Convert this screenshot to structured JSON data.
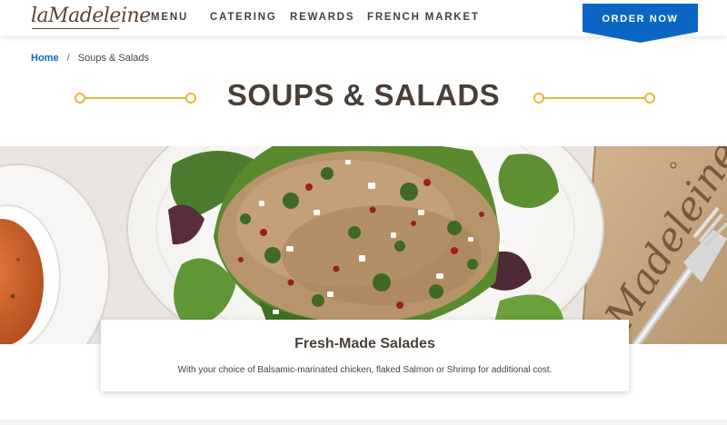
{
  "header": {
    "logo_text": "laMadeleine",
    "nav": {
      "menu": "MENU",
      "catering": "CATERING",
      "rewards": "REWARDS",
      "french_market": "FRENCH MARKET"
    },
    "order_button": "ORDER NOW"
  },
  "breadcrumb": {
    "home": "Home",
    "separator": "/",
    "current": "Soups & Salads"
  },
  "page": {
    "title": "SOUPS & SALADS"
  },
  "card": {
    "title": "Fresh-Made Salades",
    "description": "With your choice of Balsamic-marinated chicken, flaked Salmon or Shrimp for additional cost."
  },
  "hero": {
    "napkin_text": "Madeleine",
    "image_alt": "Quinoa salad with kale, cranberries and feta, tomato soup and fork on napkin"
  },
  "colors": {
    "brand_blue": "#0b66c3",
    "accent_gold": "#e5b73b",
    "text_brown": "#4a3f38"
  }
}
